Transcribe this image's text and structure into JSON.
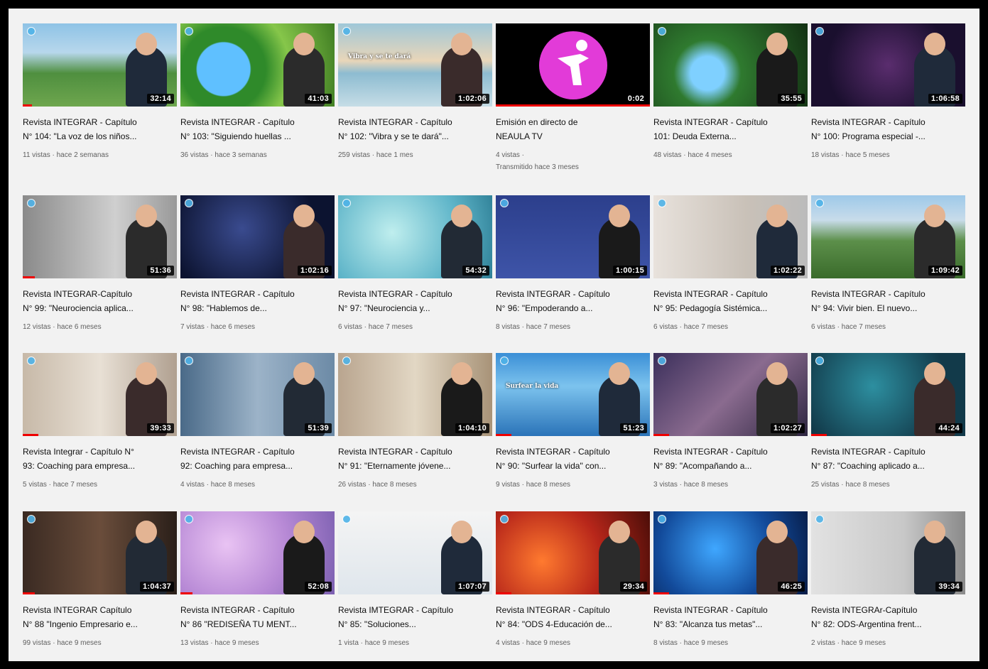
{
  "videos": [
    {
      "title1": "Revista INTEGRAR - Capítulo",
      "title2": "N° 104: \"La voz de los niños...",
      "meta1": "11 vistas · hace 2 semanas",
      "meta2": "",
      "duration": "32:14",
      "theme": "field",
      "progress": 0.06,
      "caption": ""
    },
    {
      "title1": "Revista INTEGRAR - Capítulo",
      "title2": "N° 103: \"Siguiendo huellas ...",
      "meta1": "36 vistas · hace 3 semanas",
      "meta2": "",
      "duration": "41:03",
      "theme": "globe",
      "progress": 0,
      "caption": ""
    },
    {
      "title1": "Revista INTEGRAR - Capítulo",
      "title2": "N° 102: \"Vibra y se te dará\"...",
      "meta1": "259 vistas · hace 1 mes",
      "meta2": "",
      "duration": "1:02:06",
      "theme": "sea",
      "progress": 0,
      "caption": "Vibra y se te dará"
    },
    {
      "title1": "Emisión en directo de",
      "title2": "NEAULA TV",
      "meta1": "4 vistas ·",
      "meta2": "Transmitido hace 3 meses",
      "duration": "0:02",
      "theme": "live",
      "progress": 1,
      "caption": ""
    },
    {
      "title1": "Revista INTEGRAR - Capítulo",
      "title2": "101: Deuda Externa...",
      "meta1": "48 vistas · hace 4 meses",
      "meta2": "",
      "duration": "35:55",
      "theme": "forest",
      "progress": 0,
      "caption": ""
    },
    {
      "title1": "Revista INTEGRAR - Capítulo",
      "title2": "N° 100: Programa especial -...",
      "meta1": "18 vistas · hace 5 meses",
      "meta2": "",
      "duration": "1:06:58",
      "theme": "space",
      "progress": 0,
      "caption": ""
    },
    {
      "title1": "Revista INTEGRAR-Capítulo",
      "title2": "N° 99: \"Neurociencia aplica...",
      "meta1": "12 vistas · hace 6 meses",
      "meta2": "",
      "duration": "51:36",
      "theme": "grey",
      "progress": 0.08,
      "caption": ""
    },
    {
      "title1": "Revista INTEGRAR - Capítulo",
      "title2": "N° 98: \"Hablemos de...",
      "meta1": "7 vistas · hace 6 meses",
      "meta2": "",
      "duration": "1:02:16",
      "theme": "night",
      "progress": 0,
      "caption": ""
    },
    {
      "title1": "Revista INTEGRAR - Capítulo",
      "title2": "N° 97: \"Neurociencia y...",
      "meta1": "6 vistas · hace 7 meses",
      "meta2": "",
      "duration": "54:32",
      "theme": "water",
      "progress": 0,
      "caption": ""
    },
    {
      "title1": "Revista INTEGRAR - Capítulo",
      "title2": "N° 96: \"Empoderando a...",
      "meta1": "8 vistas · hace 7 meses",
      "meta2": "",
      "duration": "1:00:15",
      "theme": "blue",
      "progress": 0,
      "caption": ""
    },
    {
      "title1": "Revista INTEGRAR - Capítulo",
      "title2": "N° 95: Pedagogía Sistémica...",
      "meta1": "6 vistas · hace 7 meses",
      "meta2": "",
      "duration": "1:02:22",
      "theme": "light",
      "progress": 0,
      "caption": ""
    },
    {
      "title1": "Revista INTEGRAR - Capítulo",
      "title2": "N° 94: Vivir bien. El nuevo...",
      "meta1": "6 vistas · hace 7 meses",
      "meta2": "",
      "duration": "1:09:42",
      "theme": "hills",
      "progress": 0,
      "caption": ""
    },
    {
      "title1": "Revista Integrar - Capítulo N°",
      "title2": "93: Coaching para empresa...",
      "meta1": "5 vistas · hace 7 meses",
      "meta2": "",
      "duration": "39:33",
      "theme": "office",
      "progress": 0.1,
      "caption": ""
    },
    {
      "title1": "Revista INTEGRAR - Capítulo",
      "title2": "92: Coaching para empresa...",
      "meta1": "4 vistas · hace 8 meses",
      "meta2": "",
      "duration": "51:39",
      "theme": "crowd",
      "progress": 0,
      "caption": ""
    },
    {
      "title1": "Revista INTEGRAR - Capítulo",
      "title2": "N° 91: \"Eternamente jóvene...",
      "meta1": "26 vistas · hace 8 meses",
      "meta2": "",
      "duration": "1:04:10",
      "theme": "elders",
      "progress": 0,
      "caption": ""
    },
    {
      "title1": "Revista INTEGRAR - Capítulo",
      "title2": "N° 90: \"Surfear la vida\" con...",
      "meta1": "9 vistas · hace 8 meses",
      "meta2": "",
      "duration": "51:23",
      "theme": "surf",
      "progress": 0.1,
      "caption": "Surfear la vida"
    },
    {
      "title1": "Revista INTEGRAR - Capítulo",
      "title2": "N° 89: \"Acompañando a...",
      "meta1": "3 vistas · hace 8 meses",
      "meta2": "",
      "duration": "1:02:27",
      "theme": "book",
      "progress": 0.1,
      "caption": ""
    },
    {
      "title1": "Revista INTEGRAR - Capítulo",
      "title2": "N° 87: \"Coaching aplicado a...",
      "meta1": "25 vistas · hace 8 meses",
      "meta2": "",
      "duration": "44:24",
      "theme": "teal",
      "progress": 0.1,
      "caption": ""
    },
    {
      "title1": "Revista INTEGRAR Capítulo",
      "title2": "N° 88 \"Ingenio Empresario e...",
      "meta1": "99 vistas · hace 9 meses",
      "meta2": "",
      "duration": "1:04:37",
      "theme": "brown",
      "progress": 0.08,
      "caption": ""
    },
    {
      "title1": "Revista INTEGRAR - Capítulo",
      "title2": "N° 86 \"REDISEÑA TU MENT...",
      "meta1": "13 vistas · hace 9 meses",
      "meta2": "",
      "duration": "52:08",
      "theme": "purple",
      "progress": 0.08,
      "caption": ""
    },
    {
      "title1": "Revista IMTEGRAR - Capítulo",
      "title2": "N° 85: \"Soluciones...",
      "meta1": "1 vista · hace 9 meses",
      "meta2": "",
      "duration": "1:07:07",
      "theme": "white",
      "progress": 0,
      "caption": ""
    },
    {
      "title1": "Revista INTEGRAR - Capítulo",
      "title2": "N° 84: \"ODS 4-Educación de...",
      "meta1": "4 vistas · hace 9 meses",
      "meta2": "",
      "duration": "29:34",
      "theme": "red",
      "progress": 0.1,
      "caption": ""
    },
    {
      "title1": "Revista INTEGRAR - Capítulo",
      "title2": "N° 83: \"Alcanza tus metas\"...",
      "meta1": "8 vistas · hace 9 meses",
      "meta2": "",
      "duration": "46:25",
      "theme": "digital",
      "progress": 0.1,
      "caption": ""
    },
    {
      "title1": "Revista INTEGRAr-Capítulo",
      "title2": "N° 82: ODS-Argentina frent...",
      "meta1": "2 vistas · hace 9 meses",
      "meta2": "",
      "duration": "39:34",
      "theme": "map",
      "progress": 0,
      "caption": ""
    }
  ]
}
